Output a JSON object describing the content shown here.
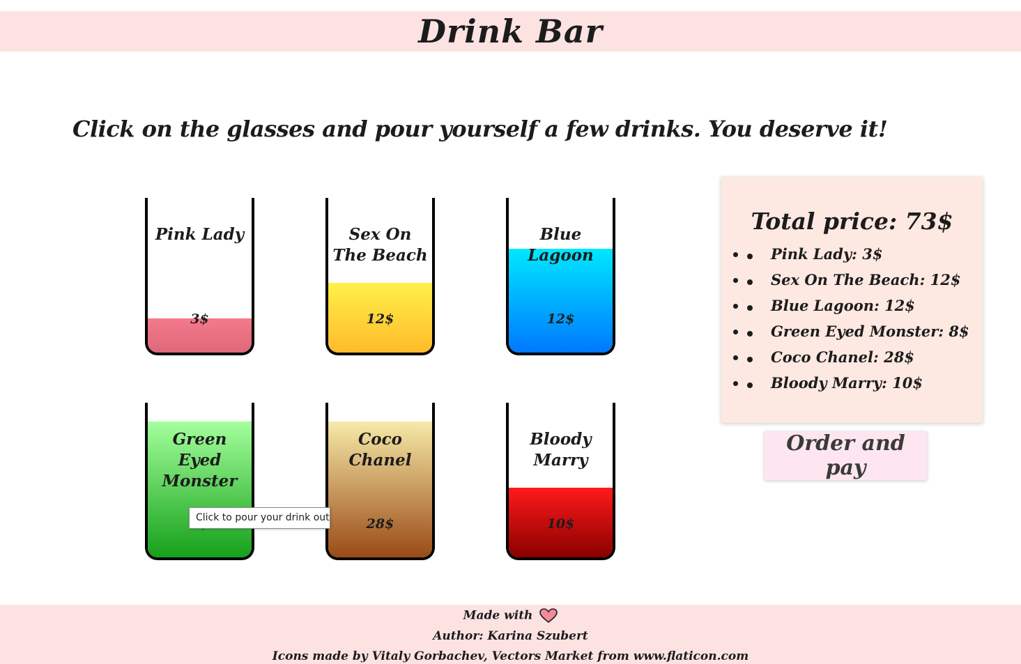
{
  "header": {
    "title": "Drink Bar"
  },
  "intro": "Click on the glasses and pour yourself a few drinks. You deserve it!",
  "glasses": [
    {
      "name": "Pink Lady",
      "price": "3$",
      "level": 0.22,
      "gradient": [
        "#f47a8c",
        "#de6879"
      ]
    },
    {
      "name": "Sex On The Beach",
      "price": "12$",
      "level": 0.45,
      "gradient": [
        "#fff04a",
        "#ffbb2a"
      ]
    },
    {
      "name": "Blue Lagoon",
      "price": "12$",
      "level": 0.67,
      "gradient": [
        "#00e8ff",
        "#0078ff"
      ]
    },
    {
      "name": "Green Eyed Monster",
      "price": "8$",
      "level": 0.88,
      "gradient": [
        "#a4ff9c",
        "#15a01a"
      ]
    },
    {
      "name": "Coco Chanel",
      "price": "28$",
      "level": 0.88,
      "gradient": [
        "#f6eaa8",
        "#9a4a16"
      ]
    },
    {
      "name": "Bloody Marry",
      "price": "10$",
      "level": 0.45,
      "gradient": [
        "#ff1a1a",
        "#8a0000"
      ]
    }
  ],
  "tooltip": "Click to pour your drink out",
  "summary": {
    "total": "Total price: 73$",
    "items": [
      "Pink Lady: 3$",
      "Sex On The Beach: 12$",
      "Blue Lagoon: 12$",
      "Green Eyed Monster: 8$",
      "Coco Chanel: 28$",
      "Bloody Marry: 10$"
    ]
  },
  "order_button": "Order and pay",
  "footer": {
    "made_with": "Made with",
    "heart_icon": "heart-icon",
    "author": "Author: Karina Szubert",
    "credits": "Icons made by Vitaly Gorbachev, Vectors Market from www.flaticon.com"
  },
  "colors": {
    "header_bg": "#fde2e2",
    "summary_bg": "#fde8e2",
    "button_bg": "#fde6ef",
    "heart": "#f28a9a"
  }
}
